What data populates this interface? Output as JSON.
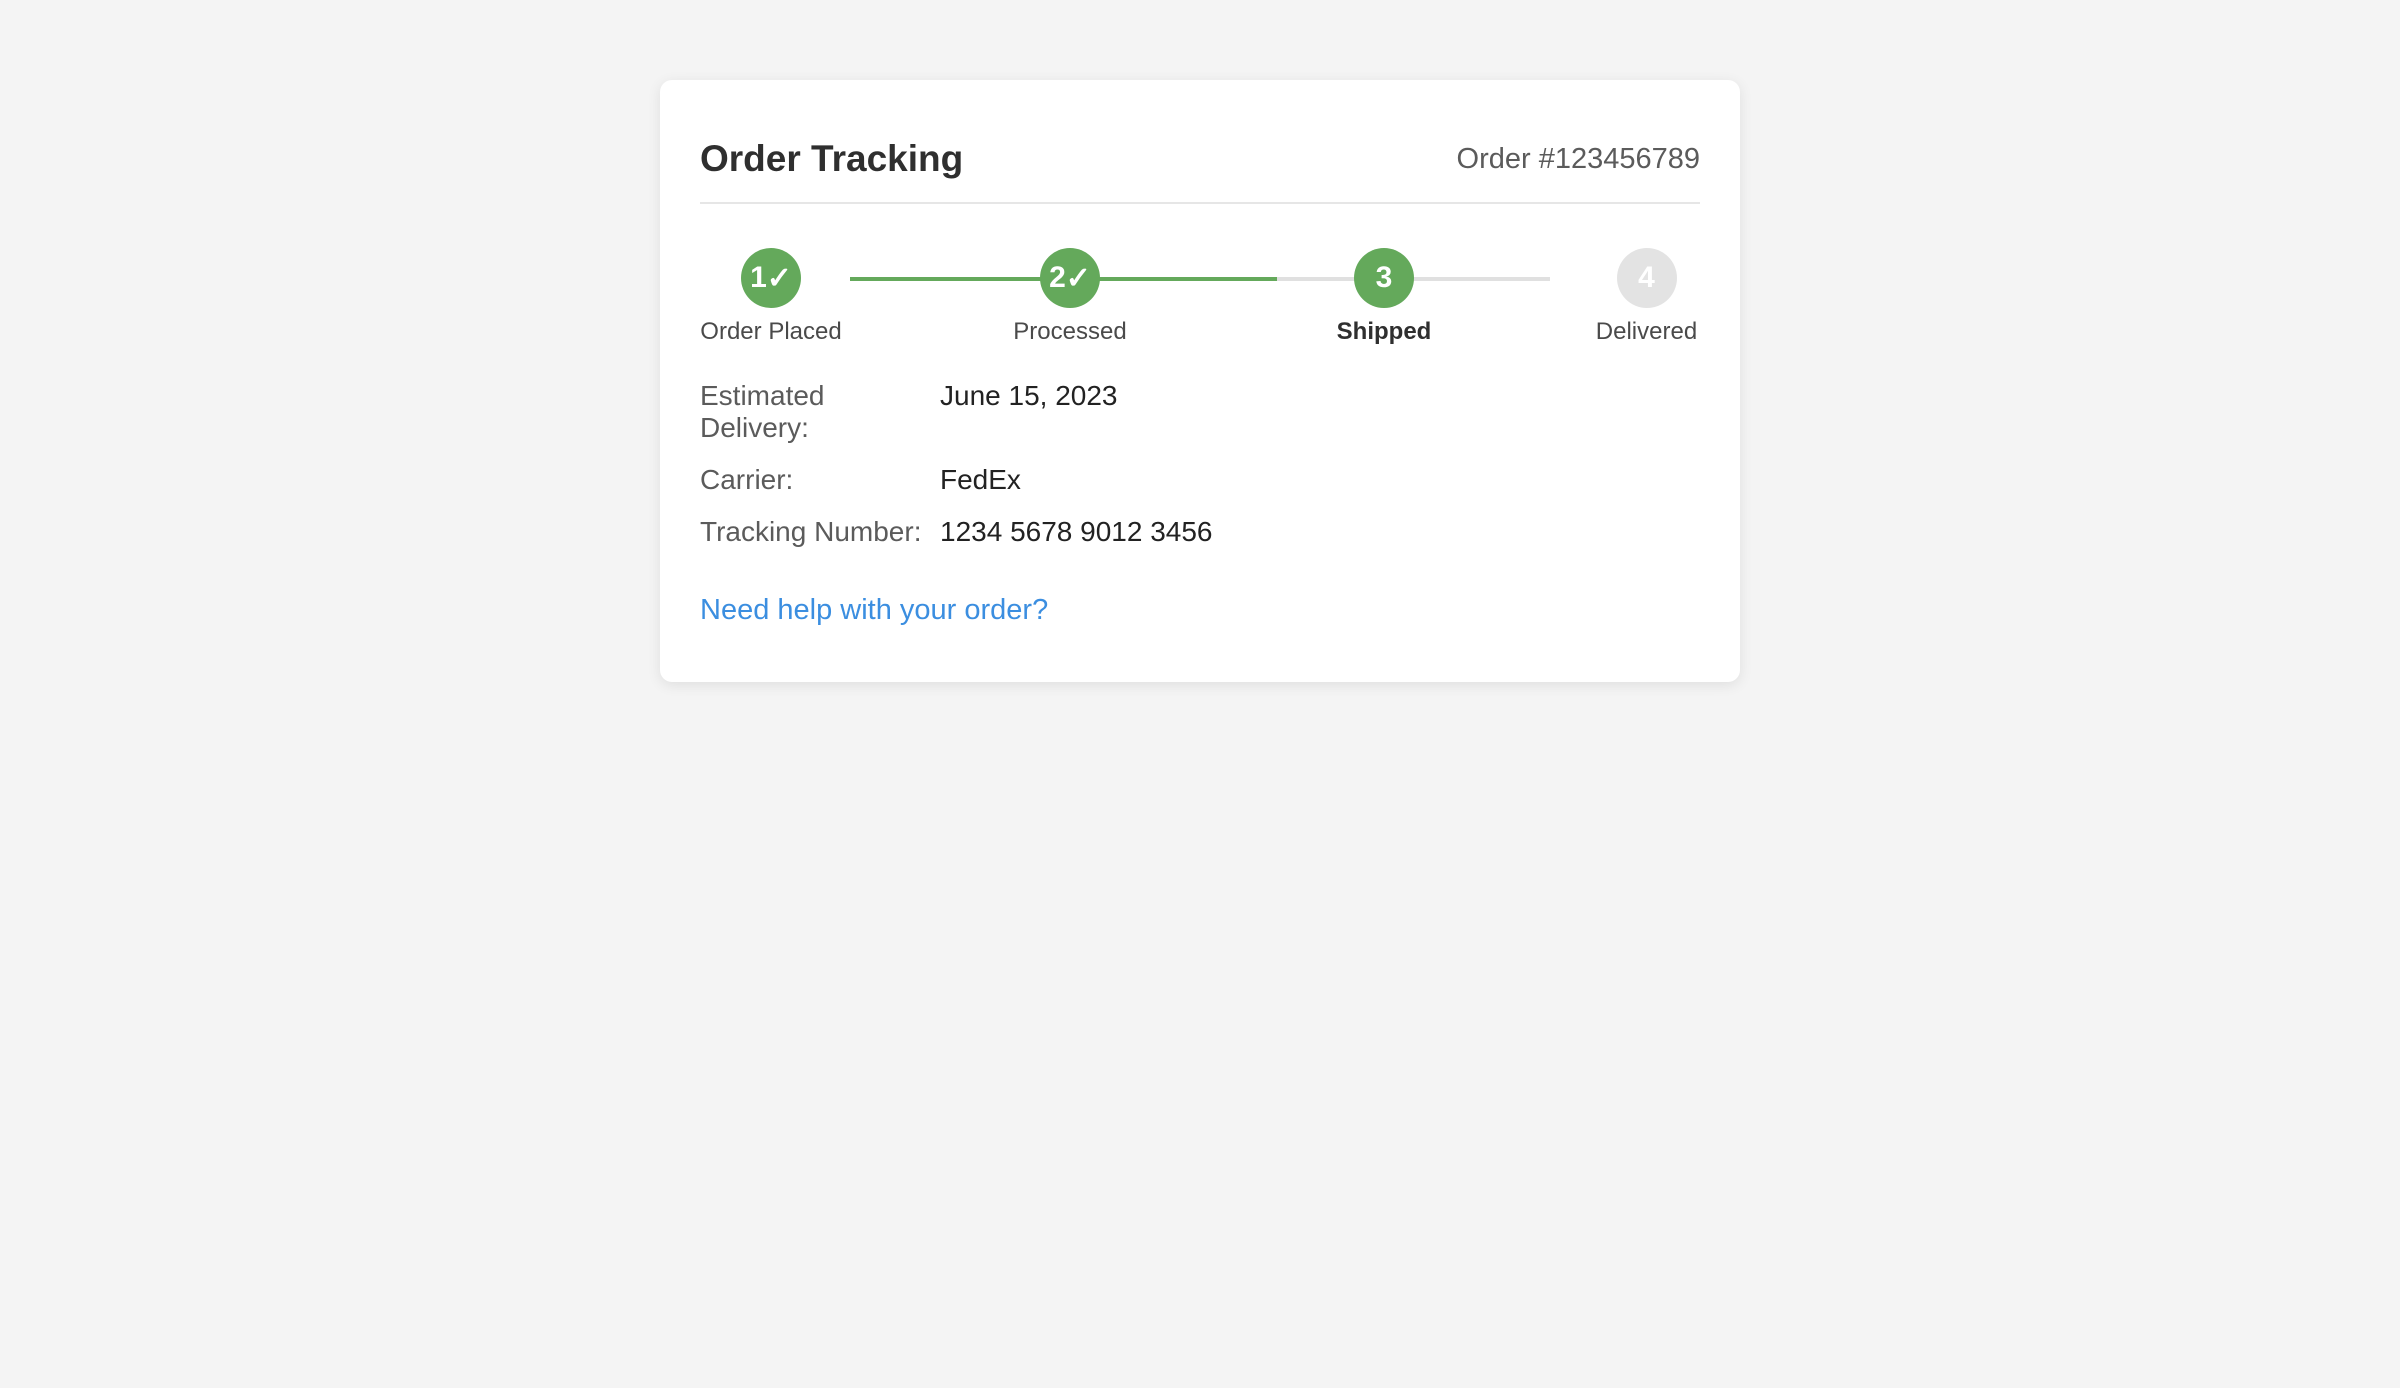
{
  "header": {
    "title": "Order Tracking",
    "order_number": "Order #123456789"
  },
  "progress": {
    "fill_fraction": 0.61,
    "steps": [
      {
        "number": "1",
        "symbol": "✓",
        "label": "Order Placed",
        "status": "completed"
      },
      {
        "number": "2",
        "symbol": "✓",
        "label": "Processed",
        "status": "completed"
      },
      {
        "number": "3",
        "symbol": "",
        "label": "Shipped",
        "status": "current"
      },
      {
        "number": "4",
        "symbol": "",
        "label": "Delivered",
        "status": "pending"
      }
    ]
  },
  "details": {
    "estimated_delivery": {
      "label": "Estimated Delivery:",
      "value": "June 15, 2023"
    },
    "carrier": {
      "label": "Carrier:",
      "value": "FedEx"
    },
    "tracking_number": {
      "label": "Tracking Number:",
      "value": "1234 5678 9012 3456"
    }
  },
  "help": {
    "label": "Need help with your order?"
  },
  "colors": {
    "background": "#f4f4f4",
    "card": "#ffffff",
    "complete": "#64a95b",
    "pending": "#e3e3e3",
    "link": "#3b8ee0"
  }
}
